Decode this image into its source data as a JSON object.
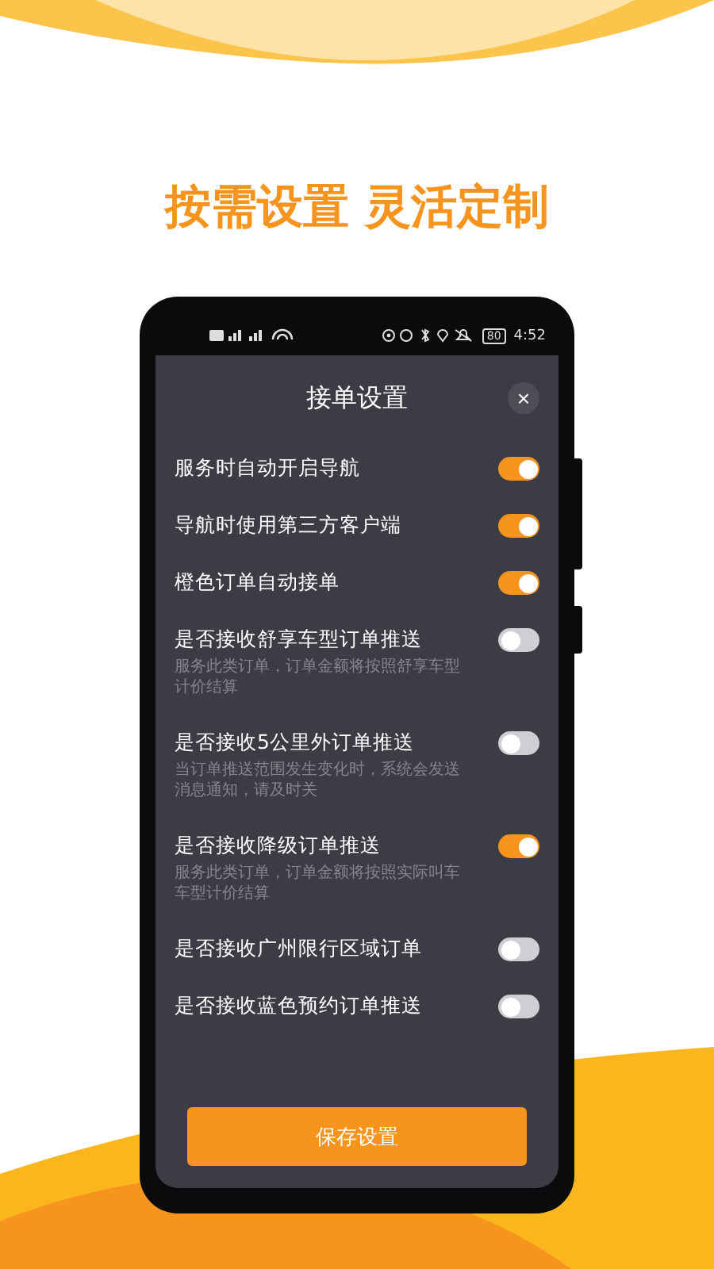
{
  "headline": "按需设置 灵活定制",
  "status_bar": {
    "battery": "80",
    "time": "4:52"
  },
  "dialog": {
    "title": "接单设置",
    "close": "×"
  },
  "settings": [
    {
      "label": "服务时自动开启导航",
      "on": true
    },
    {
      "label": "导航时使用第三方客户端",
      "on": true
    },
    {
      "label": "橙色订单自动接单",
      "on": true
    },
    {
      "label": "是否接收舒享车型订单推送",
      "description": "服务此类订单，订单金额将按照舒享车型计价结算",
      "on": false
    },
    {
      "label": "是否接收5公里外订单推送",
      "description": "当订单推送范围发生变化时，系统会发送消息通知，请及时关",
      "on": false
    },
    {
      "label": "是否接收降级订单推送",
      "description": "服务此类订单，订单金额将按照实际叫车车型计价结算",
      "on": true
    },
    {
      "label": "是否接收广州限行区域订单",
      "on": false
    },
    {
      "label": "是否接收蓝色预约订单推送",
      "on": false
    }
  ],
  "save_button": "保存设置"
}
